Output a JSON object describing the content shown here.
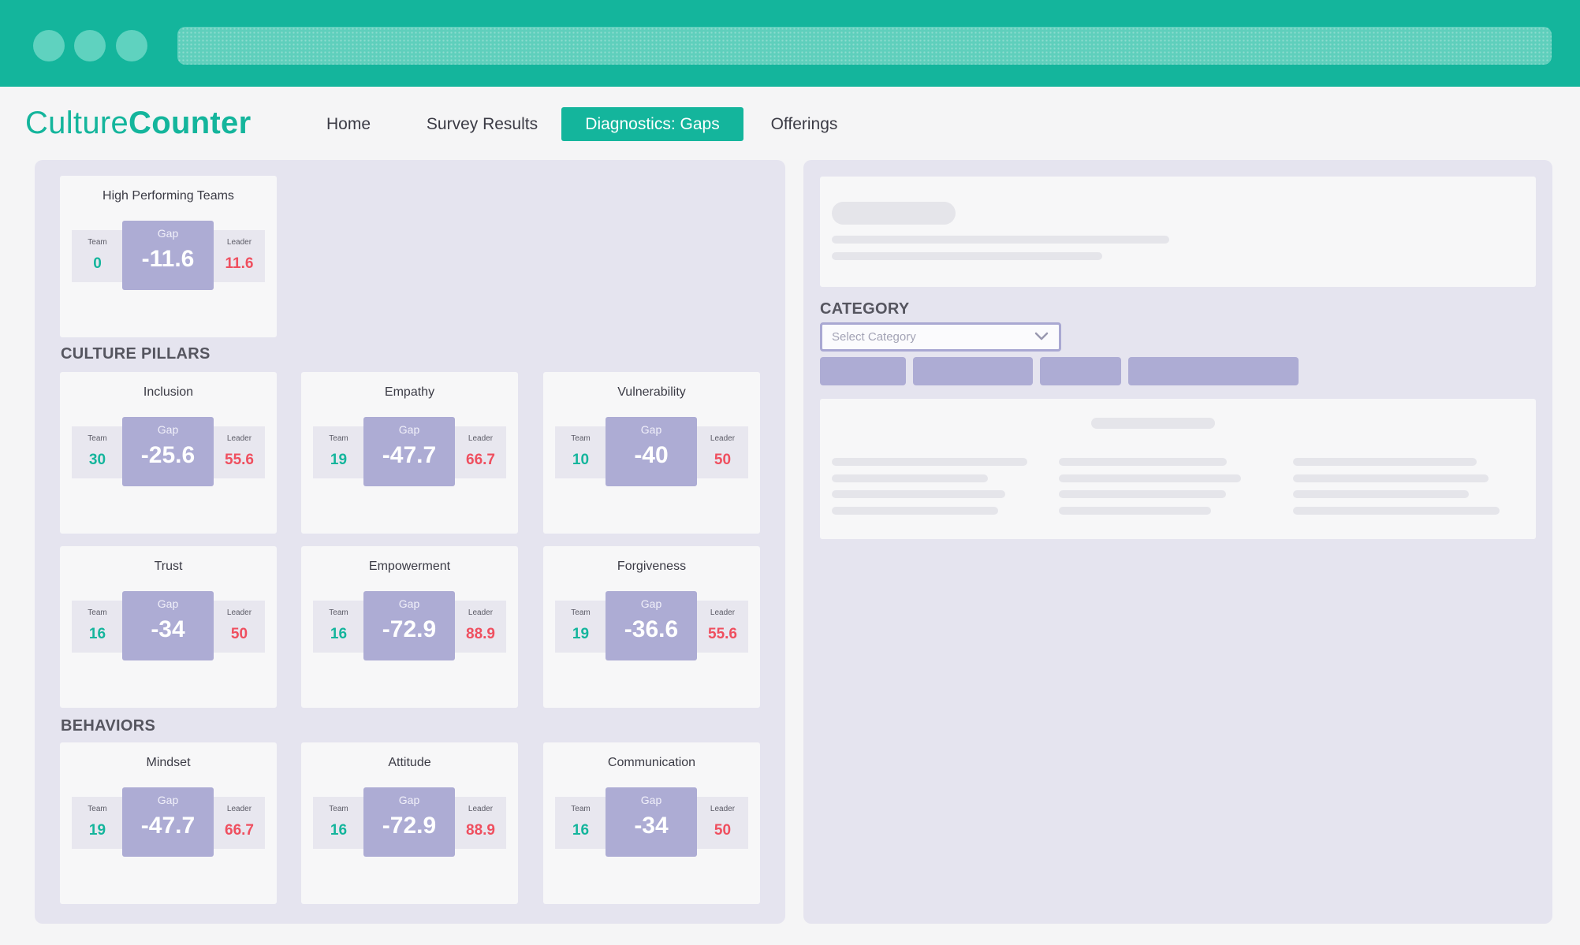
{
  "colors": {
    "accent": "#14b59c",
    "gap_tile": "#adacd4",
    "team_value": "#14b59c",
    "leader_value": "#ef4f5f"
  },
  "brand": {
    "name_light": "Culture",
    "name_bold": "Counter"
  },
  "nav": {
    "home": "Home",
    "survey_results": "Survey Results",
    "diagnostics_gaps": "Diagnostics: Gaps",
    "offerings": "Offerings"
  },
  "labels": {
    "team": "Team",
    "gap": "Gap",
    "leader": "Leader"
  },
  "summary": {
    "title": "High Performing Teams",
    "team": "0",
    "gap": "-11.6",
    "leader": "11.6"
  },
  "culture_pillars": {
    "title": "CULTURE PILLARS",
    "cards": [
      {
        "title": "Inclusion",
        "team": "30",
        "gap": "-25.6",
        "leader": "55.6"
      },
      {
        "title": "Empathy",
        "team": "19",
        "gap": "-47.7",
        "leader": "66.7"
      },
      {
        "title": "Vulnerability",
        "team": "10",
        "gap": "-40",
        "leader": "50"
      },
      {
        "title": "Trust",
        "team": "16",
        "gap": "-34",
        "leader": "50"
      },
      {
        "title": "Empowerment",
        "team": "16",
        "gap": "-72.9",
        "leader": "88.9"
      },
      {
        "title": "Forgiveness",
        "team": "19",
        "gap": "-36.6",
        "leader": "55.6"
      }
    ]
  },
  "behaviors": {
    "title": "BEHAVIORS",
    "cards": [
      {
        "title": "Mindset",
        "team": "19",
        "gap": "-47.7",
        "leader": "66.7"
      },
      {
        "title": "Attitude",
        "team": "16",
        "gap": "-72.9",
        "leader": "88.9"
      },
      {
        "title": "Communication",
        "team": "16",
        "gap": "-34",
        "leader": "50"
      }
    ]
  },
  "category": {
    "title": "CATEGORY",
    "placeholder": "Select Category",
    "icon": "chevron-down-icon"
  }
}
